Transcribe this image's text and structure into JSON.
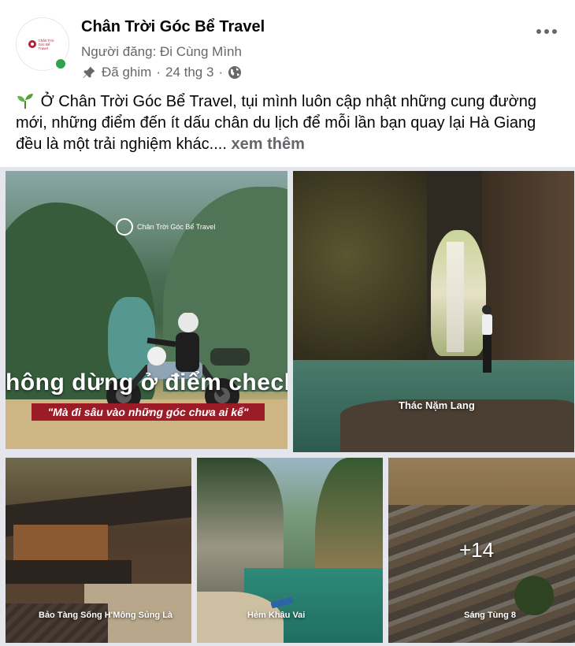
{
  "post": {
    "page_name": "Chân Trời Góc Bể Travel",
    "poster": "Người đăng: Đi Cùng Mình",
    "pinned": "Đã ghim",
    "separator": "·",
    "date": "24 thg 3",
    "avatar_logo_text": "Chân Trời Góc Bể Travel",
    "text": "Ở Chân Trời Góc Bể Travel, tụi mình luôn cập nhật những cung đường mới, những điểm đến ít dấu chân du lịch để mỗi lần bạn quay lại Hà Giang đều là một trải nghiệm khác....",
    "see_more": "xem thêm",
    "icons": {
      "more": "more-dots-icon",
      "pin": "pin-icon",
      "privacy": "globe-icon",
      "emoji": "seedling-icon"
    }
  },
  "photos": {
    "p1": {
      "logo_text": "Chân Trời Góc Bể Travel",
      "headline": "hông dừng ở điểm check-",
      "quote": "\"Mà đi sâu vào những góc chưa ai kể\""
    },
    "p2": {
      "caption": "Thác Nặm Lang"
    },
    "p3": {
      "caption": "Bảo Tàng Sống H'Mông Sủng Là"
    },
    "p4": {
      "caption": "Hẻm Khâu Vai"
    },
    "p5": {
      "caption": "Sáng Tùng 8",
      "more_count": "+14"
    }
  },
  "colors": {
    "text_primary": "#050505",
    "text_secondary": "#65676b",
    "online": "#31a24c",
    "brand_red": "#9b1c26"
  }
}
